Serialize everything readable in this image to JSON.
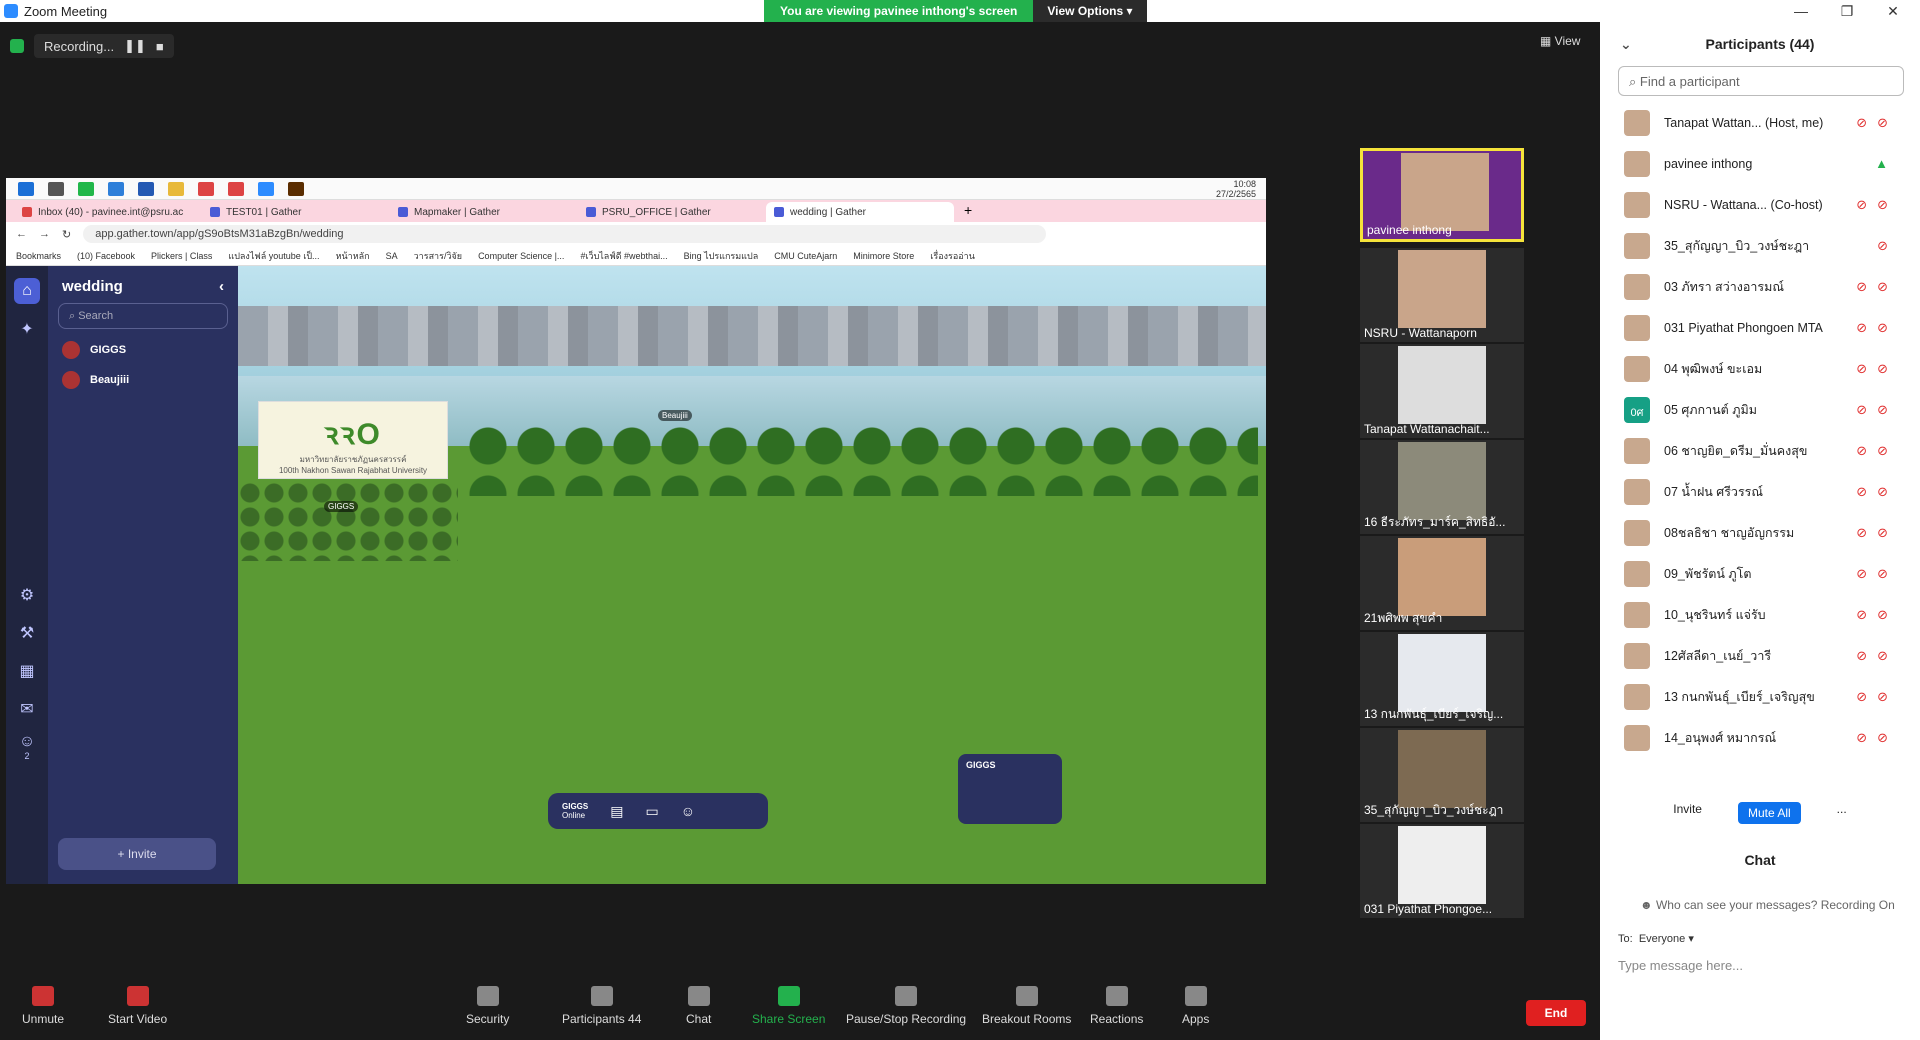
{
  "window": {
    "title": "Zoom Meeting"
  },
  "banner": {
    "message": "You are viewing pavinee inthong's screen",
    "view_options": "View Options"
  },
  "recording": {
    "label": "Recording..."
  },
  "view_button": "View",
  "shared": {
    "clock_time": "10:08",
    "clock_date": "27/2/2565",
    "tabs": [
      "Inbox (40) - pavinee.int@psru.ac",
      "TEST01 | Gather",
      "Mapmaker | Gather",
      "PSRU_OFFICE | Gather",
      "wedding | Gather"
    ],
    "url": "app.gather.town/app/gS9oBtsM31aBzgBn/wedding",
    "bookmarks": [
      "Bookmarks",
      "(10) Facebook",
      "Plickers | Class",
      "แปลงไฟล์ youtube เป็...",
      "หน้าหลัก",
      "SA",
      "วารสาร/วิจัย",
      "Computer Science |...",
      "#เว็บไลฟ์ดี #webthai...",
      "Bing ไปรแกรมแปล",
      "CMU CuteAjarn",
      "Minimore Store",
      "เรื่องรออ่าน"
    ]
  },
  "gather": {
    "space": "wedding",
    "search_placeholder": "Search",
    "players": [
      "GIGGS",
      "Beaujiii"
    ],
    "invite": "Invite",
    "online_count": "2",
    "logo_caption": "มหาวิทยาลัยราชภัฏนครสวรรค์",
    "logo_sub": "100th Nakhon Sawan Rajabhat University",
    "bar_name": "GIGGS",
    "bar_status": "Online",
    "card_name": "GIGGS",
    "tag_beaujiii": "Beaujiii",
    "tag_giggs": "GIGGS"
  },
  "thumbnails": [
    "pavinee inthong",
    "NSRU - Wattanaporn",
    "Tanapat Wattanachait...",
    "16 ธีระภัทร_มาร์ค_สิทธิอั...",
    "21พศิพพ สุขคำ",
    "13 กนกพันธุ์_เบียร์_เจริญ...",
    "35_สุกัญญา_บิว_วงษ์ชะฎา",
    "031 Piyathat Phongoe..."
  ],
  "toolbar": {
    "mute": "Unmute",
    "video": "Start Video",
    "security": "Security",
    "participants": "Participants",
    "participants_count": "44",
    "chat": "Chat",
    "share": "Share Screen",
    "record": "Pause/Stop Recording",
    "breakout": "Breakout Rooms",
    "reactions": "Reactions",
    "apps": "Apps",
    "end": "End"
  },
  "panel": {
    "title": "Participants (44)",
    "search_placeholder": "Find a participant",
    "participants": [
      {
        "name": "Tanapat Wattan...",
        "role": "(Host, me)"
      },
      {
        "name": "pavinee inthong",
        "role": ""
      },
      {
        "name": "NSRU - Wattana...",
        "role": "(Co-host)"
      },
      {
        "name": "35_สุกัญญา_บิว_วงษ์ชะฎา",
        "role": ""
      },
      {
        "name": "03 ภัทรา สว่างอารมณ์",
        "role": ""
      },
      {
        "name": "031 Piyathat Phongoen MTA",
        "role": ""
      },
      {
        "name": "04 พุฒิพงษ์ ขะเอม",
        "role": ""
      },
      {
        "name": "05 ศุภกานต์ ภูมิม",
        "role": "",
        "initials": "0ศ"
      },
      {
        "name": "06 ชาญยิต_ดรีม_มั่นคงสุข",
        "role": ""
      },
      {
        "name": "07 น้ำฝน ศรีวรรณ์",
        "role": ""
      },
      {
        "name": "08ชลธิชา ชาญอัญกรรม",
        "role": ""
      },
      {
        "name": "09_พัชรัตน์ ภูโต",
        "role": ""
      },
      {
        "name": "10_นุชรินทร์ แจ่รับ",
        "role": ""
      },
      {
        "name": "12ศัสลีดา_เนย์_วารี",
        "role": ""
      },
      {
        "name": "13 กนกพันธุ์_เบียร์_เจริญสุข",
        "role": ""
      },
      {
        "name": "14_อนุพงศ์ หมากรณ์",
        "role": ""
      }
    ],
    "invite": "Invite",
    "mute_all": "Mute All",
    "more": "...",
    "chat_title": "Chat",
    "chat_note": "Who can see your messages? Recording On",
    "to_label": "To:",
    "to_value": "Everyone",
    "message_placeholder": "Type message here..."
  }
}
